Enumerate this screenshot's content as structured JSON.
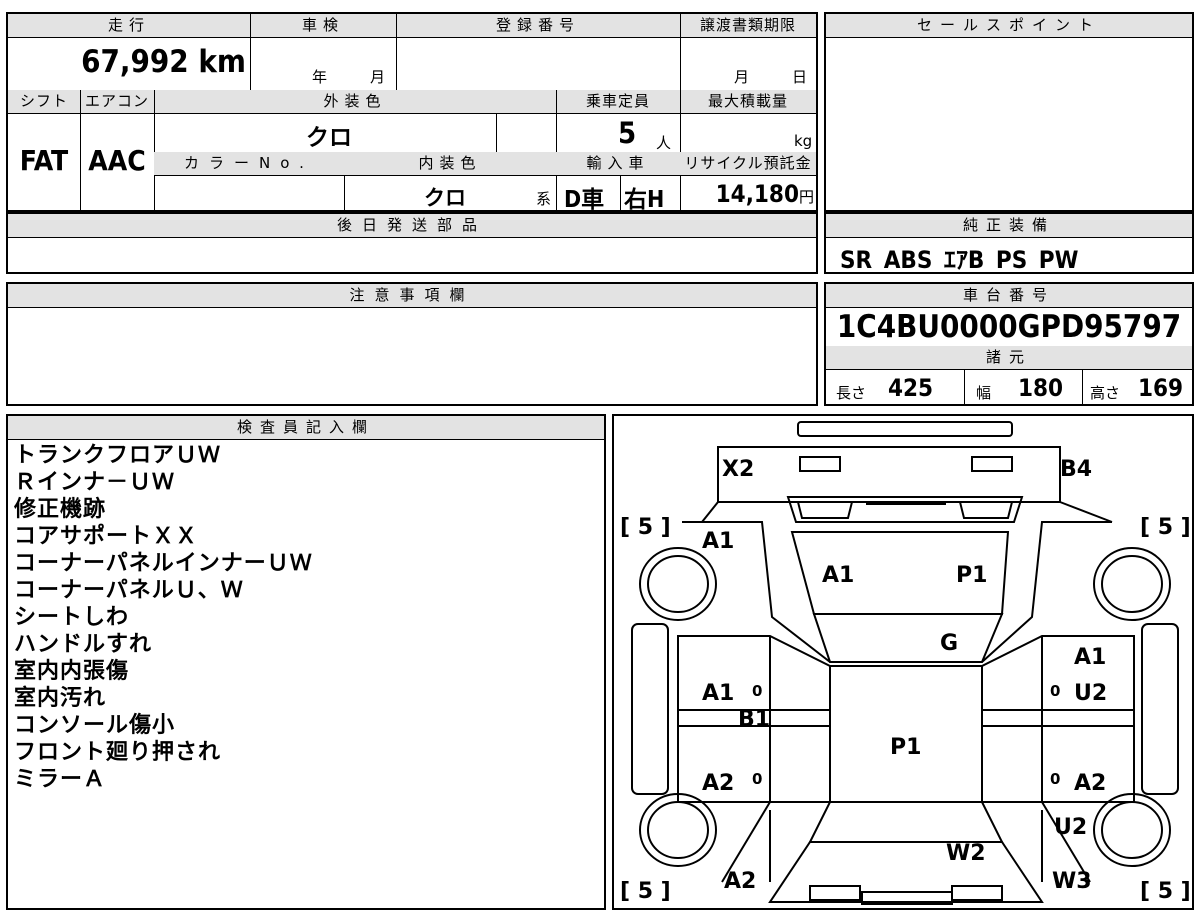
{
  "top_row": {
    "mileage_header": "走行",
    "mileage_value": "67,992",
    "mileage_unit": "km",
    "inspection_header": "車検",
    "inspection_year_unit": "年",
    "inspection_month_unit": "月",
    "registration_header": "登録番号",
    "transfer_header": "譲渡書類期限",
    "transfer_month_unit": "月",
    "transfer_day_unit": "日"
  },
  "sales_point": {
    "header": "セールスポイント"
  },
  "row2": {
    "shift_header": "シフト",
    "shift_value": "FAT",
    "aircon_header": "エアコン",
    "aircon_value": "AAC",
    "exterior_color_header": "外装色",
    "exterior_color_value": "クロ",
    "capacity_header": "乗車定員",
    "capacity_value": "5",
    "capacity_unit": "人",
    "max_load_header": "最大積載量",
    "max_load_unit": "kg",
    "color_no_header": "カラーNo.",
    "interior_color_header": "内装色",
    "interior_color_value": "クロ",
    "interior_color_suffix": "系",
    "import_header": "輸入車",
    "import_d": "D車",
    "import_h": "右H",
    "recycle_header": "リサイクル預託金",
    "recycle_value": "14,180",
    "recycle_unit": "円"
  },
  "later_parts": {
    "header": "後日発送部品"
  },
  "genuine_equipment": {
    "header": "純正装備",
    "value": "SR ABS ｴｱB PS PW"
  },
  "caution": {
    "header": "注意事項欄"
  },
  "chassis": {
    "header": "車台番号",
    "value": "1C4BU0000GPD95797"
  },
  "specs": {
    "header": "諸元",
    "length_label": "長さ",
    "length_value": "425",
    "width_label": "幅",
    "width_value": "180",
    "height_label": "高さ",
    "height_value": "169"
  },
  "inspector": {
    "header": "検査員記入欄",
    "notes": [
      "トランクフロアＵＷ",
      "Ｒインナ－ＵＷ",
      "修正機跡",
      "コアサポートＸＸ",
      "コーナーパネルインナーＵＷ",
      "コーナーパネルＵ、Ｗ",
      "シートしわ",
      "ハンドルすれ",
      "室内内張傷",
      "室内汚れ",
      "コンソール傷小",
      "フロント廻り押され",
      "ミラーＡ"
    ]
  },
  "diagram": {
    "tire_fl": "[ 5 ]",
    "tire_fr": "[ 5 ]",
    "tire_rl": "[ 5 ]",
    "tire_rr": "[ 5 ]",
    "rear_left": "X2",
    "rear_right": "B4",
    "rear_quarter_left": "A1",
    "trunk_a": "A1",
    "trunk_p": "P1",
    "glass": "G",
    "right_rear_door_a": "A1",
    "right_rear_door_u": "U2",
    "left_rear_door": "A1",
    "left_pillar": "B1",
    "roof": "P1",
    "left_front_door": "A2",
    "right_front_door": "A2",
    "right_fender": "U2",
    "hood": "W2",
    "front_right": "W3",
    "front_left": "A2",
    "door_zero_1": "0",
    "door_zero_2": "0",
    "door_zero_3": "0",
    "door_zero_4": "0"
  },
  "colors": {
    "header_bg": "#e3e3e3",
    "line": "#000000"
  }
}
